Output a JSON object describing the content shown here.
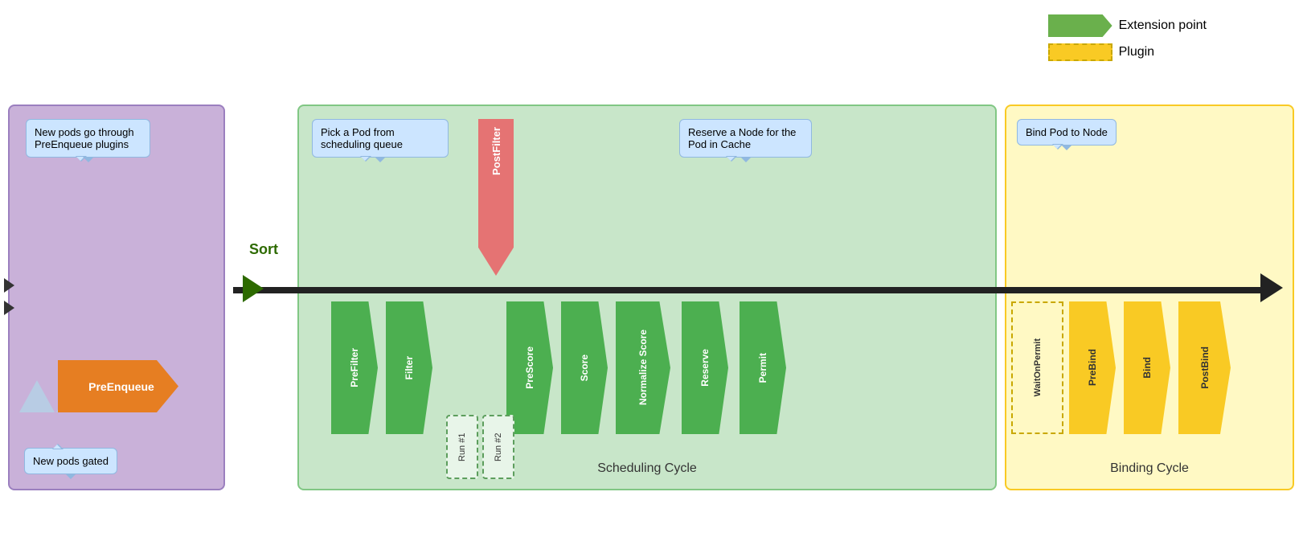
{
  "legend": {
    "green_label": "Extension point",
    "yellow_label": "Plugin"
  },
  "sections": {
    "prequeue": {
      "bubble_new_pods": "New pods go through PreEnqueue plugins",
      "preenqueue_label": "PreEnqueue",
      "bubble_gated": "New pods gated"
    },
    "sort": {
      "label": "Sort"
    },
    "scheduling": {
      "label": "Scheduling Cycle",
      "bubble_pick_pod": "Pick a Pod from scheduling queue",
      "bubble_reserve": "Reserve a Node for the Pod in Cache",
      "plugins": {
        "prefilter": "PreFilter",
        "filter": "Filter",
        "prescore": "PreScore",
        "score": "Score",
        "normalize_score": "Normalize Score",
        "reserve": "Reserve",
        "permit": "Permit"
      },
      "post_filter": "PostFilter",
      "run1": "Run #1",
      "run2": "Run #2"
    },
    "binding": {
      "label": "Binding Cycle",
      "bubble_bind": "Bind Pod to Node",
      "wait_on_permit": "WaitOnPermit",
      "plugins": {
        "prebind": "PreBind",
        "bind": "Bind",
        "postbind": "PostBind"
      }
    }
  }
}
